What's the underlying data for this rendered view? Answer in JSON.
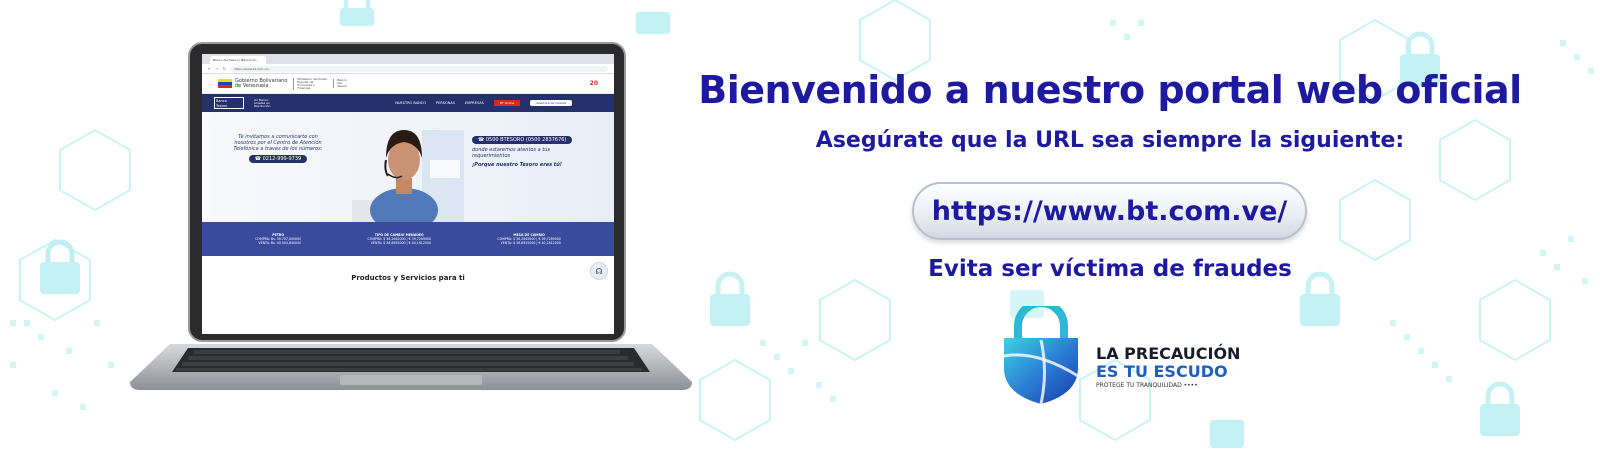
{
  "browser": {
    "tab_title": "Banco del Tesoro | Banca Un...",
    "url": "https://www.bt.com.ve/"
  },
  "site": {
    "gov_line1": "Gobierno Bolivariano",
    "gov_line2": "de Venezuela",
    "ministry": "Ministerio del Poder Popular de Economía y Finanzas",
    "bank_line": "Banco del Tesoro",
    "anniversary_logo": "20",
    "bank_logo_line1": "Banco",
    "bank_logo_line2": "Tesoro",
    "slogan": "Un Banco amable en Revolución",
    "nav": [
      "NUESTRO BANCO",
      "PERSONAS",
      "EMPRESAS"
    ],
    "nav_btn_login": "BT Online",
    "nav_btn_account": "Apertura de Cuenta",
    "hero_left_text": "Te invitamos a comunicarte con nosotros por el Centro de Atención Telefónica a través de los números:",
    "hero_left_phone": "0212-999-9739",
    "hero_right_phone": "0500 BTESORO (0500 2837676)",
    "hero_right_text": "donde estaremos atentos a tus requerimientos",
    "hero_right_tagline": "¡Porque nuestro Tesoro eres tú!",
    "rates": [
      {
        "title": "PETRO",
        "buy": "COMPRA: Bs. 39.707,000000",
        "sell": "VENTA: Bs. 40.504,840000"
      },
      {
        "title": "TIPO DE CAMBIO MENUDEO",
        "buy": "COMPRA: $ 36,2645000 | € 39,7269000",
        "sell": "VENTA: $ 36,6955000 | € 40,1812000"
      },
      {
        "title": "MESA DE CAMBIO",
        "buy": "COMPRA: $ 36,2645000 | € 39,7269000",
        "sell": "VENTA: $ 36,6955000 | € 40,1812000"
      }
    ],
    "products_title": "Productos y Servicios para ti"
  },
  "banner": {
    "title": "Bienvenido a nuestro portal web oficial",
    "subtitle": "Asegúrate que la URL sea siempre la siguiente:",
    "url": "https://www.bt.com.ve/",
    "warning": "Evita ser víctima de fraudes",
    "campaign_line1": "LA PRECAUCIÓN",
    "campaign_line2": "ES TU ESCUDO",
    "campaign_tagline": "PROTEGE TU TRANQUILIDAD ••••"
  },
  "colors": {
    "brand_blue": "#1d1aa0",
    "nav_blue": "#25316a",
    "rates_blue": "#3a4a9c",
    "accent_light_blue": "#1d5fbf",
    "pattern_cyan": "#bdf0f3"
  }
}
